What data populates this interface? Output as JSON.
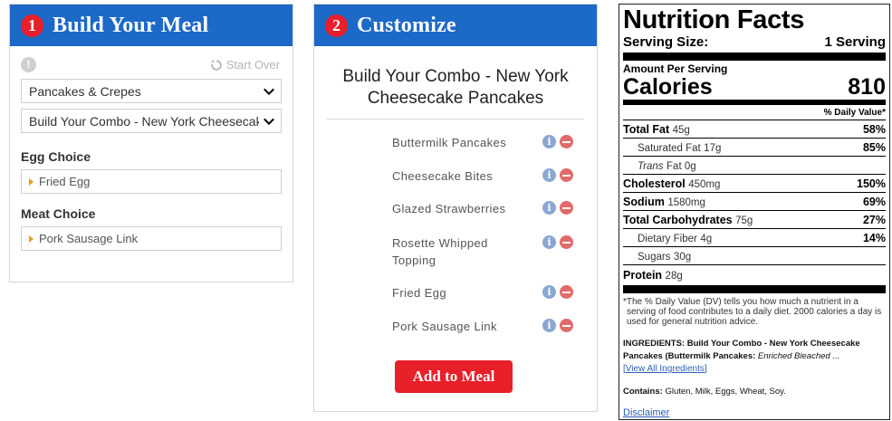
{
  "build": {
    "step": "1",
    "title": "Build Your Meal",
    "start_over": "Start Over",
    "category": "Pancakes & Crepes",
    "item": "Build Your Combo - New York Cheesecake Pancakes",
    "egg_label": "Egg Choice",
    "egg_value": "Fried Egg",
    "meat_label": "Meat Choice",
    "meat_value": "Pork Sausage Link"
  },
  "customize": {
    "step": "2",
    "title": "Customize",
    "combo_title": "Build Your Combo - New York Cheesecake Pancakes",
    "ingredients": [
      "Buttermilk Pancakes",
      "Cheesecake Bites",
      "Glazed Strawberries",
      "Rosette Whipped Topping",
      "Fried Egg",
      "Pork Sausage Link"
    ],
    "add_button": "Add to Meal"
  },
  "nutrition": {
    "title": "Nutrition Facts",
    "serving_label": "Serving Size:",
    "serving_value": "1 Serving",
    "amount_per": "Amount Per Serving",
    "calories_label": "Calories",
    "calories_value": "810",
    "dv_header": "% Daily Value*",
    "rows": [
      {
        "name": "Total Fat",
        "amount": "45g",
        "dv": "58%"
      },
      {
        "name": "Saturated Fat",
        "amount": "17g",
        "dv": "85%"
      },
      {
        "name": "Trans",
        "amount": "Fat 0g",
        "dv": ""
      },
      {
        "name": "Cholesterol",
        "amount": "450mg",
        "dv": "150%"
      },
      {
        "name": "Sodium",
        "amount": "1580mg",
        "dv": "69%"
      },
      {
        "name": "Total Carbohydrates",
        "amount": "75g",
        "dv": "27%"
      },
      {
        "name": "Dietary Fiber",
        "amount": "4g",
        "dv": "14%"
      },
      {
        "name": "Sugars",
        "amount": "30g",
        "dv": ""
      },
      {
        "name": "Protein",
        "amount": "28g",
        "dv": ""
      }
    ],
    "footnote": "*The % Daily Value (DV) tells you how much a nutrient in a serving of food contributes to a daily diet. 2000 calories a day is used for general nutrition advice.",
    "ingredients_label": "INGREDIENTS:",
    "ingredients_text": "Build Your Combo - New York Cheesecake Pancakes (Buttermilk Pancakes:",
    "ingredients_italic": "Enriched Bleached ...",
    "view_all": "View All Ingredients",
    "contains_label": "Contains:",
    "contains_text": "Gluten, Milk, Eggs, Wheat, Soy.",
    "disclaimer": "Disclaimer"
  }
}
